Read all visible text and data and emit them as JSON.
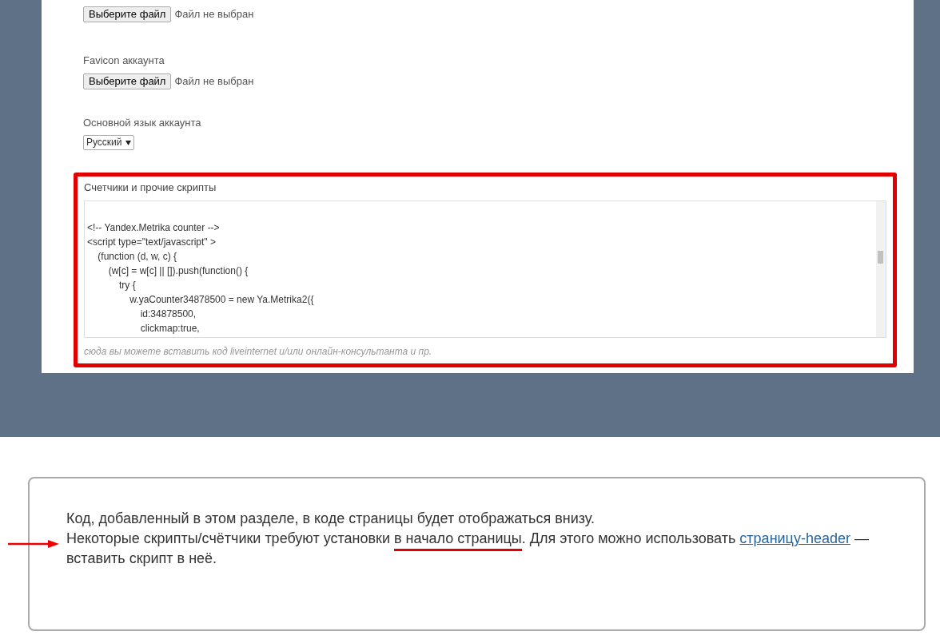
{
  "settings_form": {
    "fields": [
      {
        "kind": "file",
        "button": "Выберите файл",
        "status": "Файл не выбран"
      },
      {
        "kind": "file",
        "label": "Favicon аккаунта",
        "button": "Выберите файл",
        "status": "Файл не выбран"
      },
      {
        "kind": "select",
        "label": "Основной язык аккаунта",
        "value": "Русский"
      }
    ],
    "scripts_section": {
      "label": "Счетчики и прочие скрипты",
      "highlighted": true,
      "code_lines": [
        "<!-- Yandex.Metrika counter -->",
        "<script type=\"text/javascript\" >",
        "    (function (d, w, c) {",
        "        (w[c] = w[c] || []).push(function() {",
        "            try {",
        "                w.yaCounter34878500 = new Ya.Metrika2({",
        "                    id:34878500,",
        "                    clickmap:true,"
      ],
      "hint": "сюда вы можете вставить код liveinternet и/или онлайн-консультанта и пр."
    }
  },
  "note": {
    "line_1": "Код, добавленный в этом разделе, в коде страницы будет отображаться внизу.",
    "line_2": [
      {
        "kind": "plain",
        "text": "Некоторые скрипты/счётчики требуют установки "
      },
      {
        "kind": "underlined",
        "text": "в начало страницы"
      },
      {
        "kind": "plain",
        "text": ". Для этого можно использовать "
      },
      {
        "kind": "link",
        "text": "страницу-header"
      },
      {
        "kind": "plain",
        "text": " — вставить скрипт в неё."
      }
    ]
  }
}
